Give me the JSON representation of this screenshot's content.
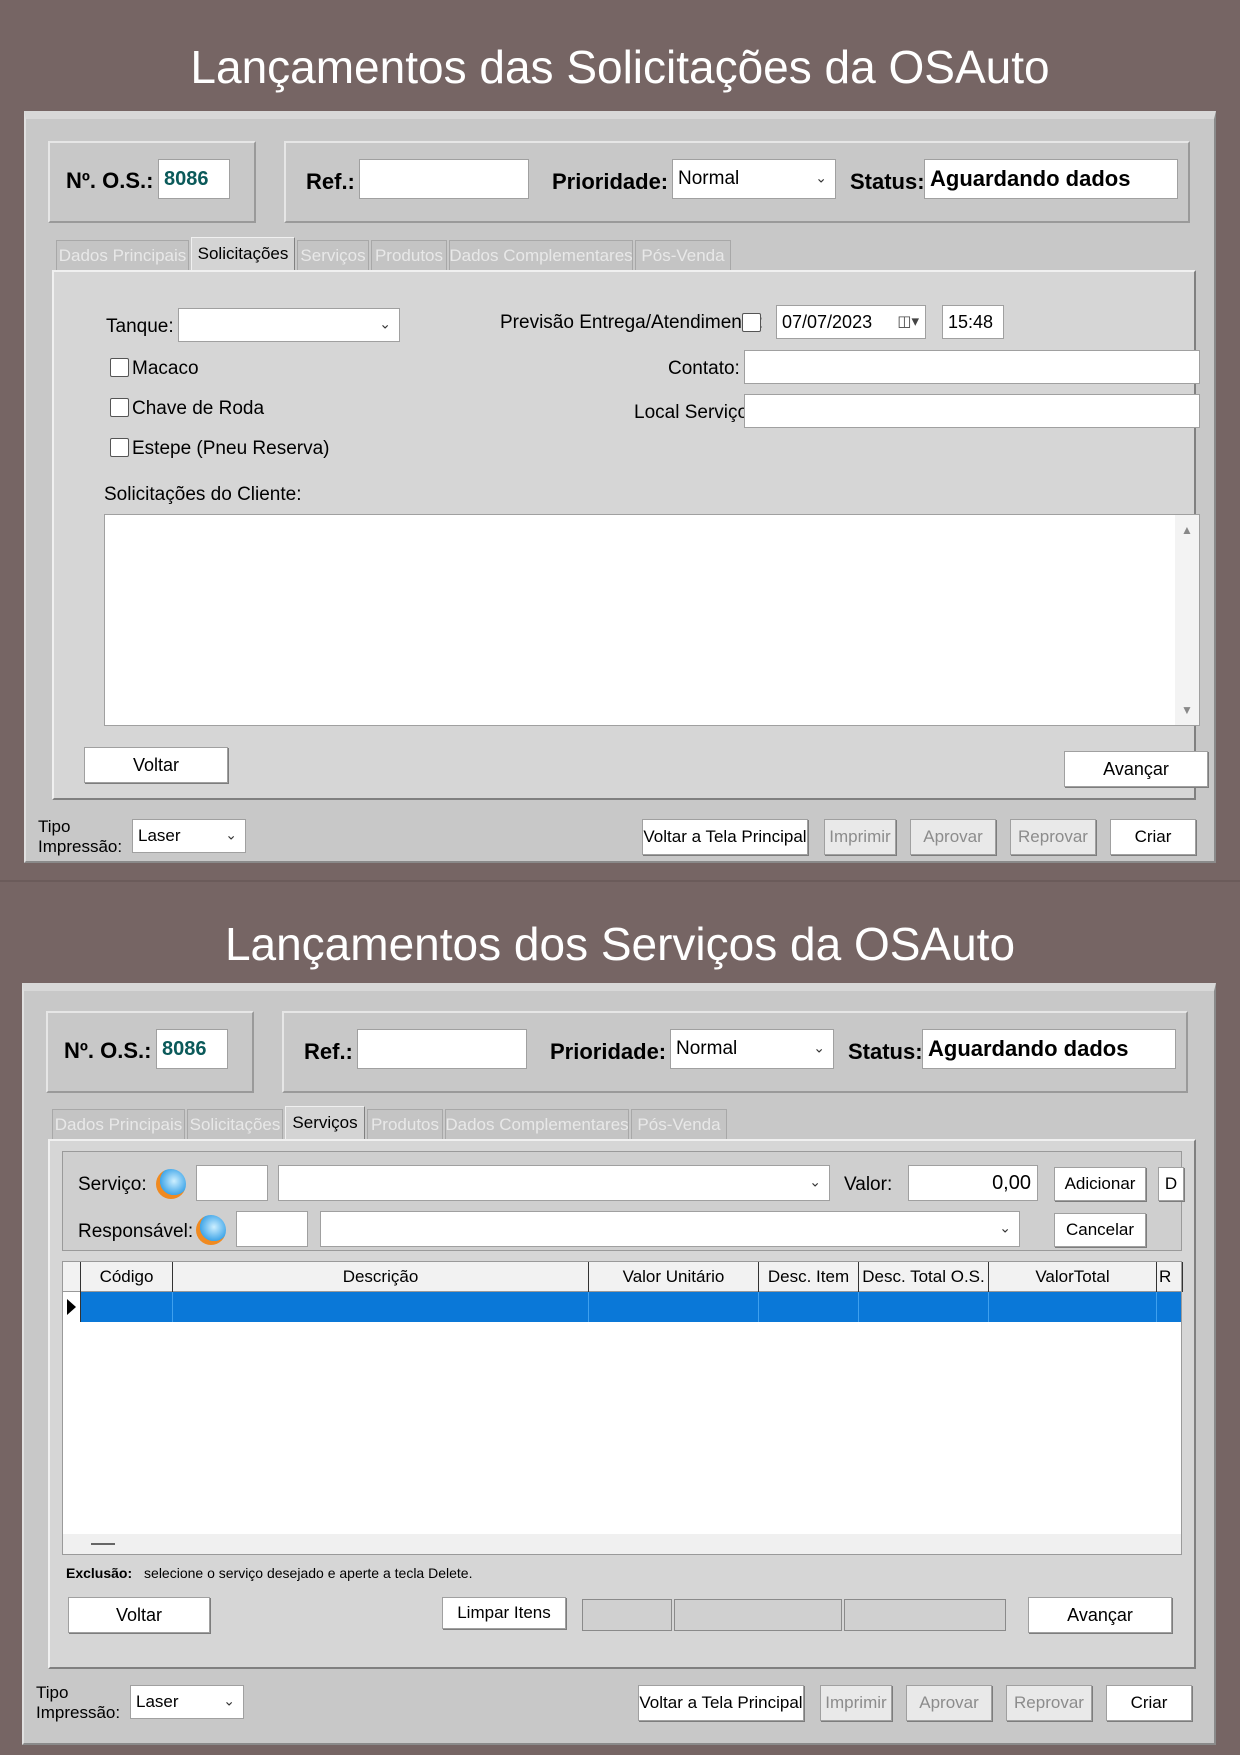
{
  "titles": {
    "top": "Lançamentos das Solicitações da OSAuto",
    "bottom": "Lançamentos dos Serviços da OSAuto"
  },
  "colors": {
    "background": "#766564",
    "window": "#c8c8c8",
    "selection": "#0a78d8",
    "os_number": "#0b5a5a"
  },
  "header": {
    "os_label": "Nº. O.S.:",
    "os_value": "8086",
    "ref_label": "Ref.:",
    "ref_value": "",
    "priority_label": "Prioridade:",
    "priority_value": "Normal",
    "status_label": "Status:",
    "status_value": "Aguardando dados"
  },
  "tabs": [
    {
      "label": "Dados Principais"
    },
    {
      "label": "Solicitações"
    },
    {
      "label": "Serviços"
    },
    {
      "label": "Produtos"
    },
    {
      "label": "Dados Complementares"
    },
    {
      "label": "Pós-Venda"
    }
  ],
  "solicitacoes": {
    "tank_label": "Tanque:",
    "tank_value": "",
    "checkboxes": [
      {
        "label": "Macaco",
        "checked": false
      },
      {
        "label": "Chave de Roda",
        "checked": false
      },
      {
        "label": "Estepe (Pneu Reserva)",
        "checked": false
      }
    ],
    "forecast_label": "Previsão Entrega/Atendimento:",
    "forecast_checked": false,
    "forecast_date": "07/07/2023",
    "forecast_time": "15:48",
    "contact_label": "Contato:",
    "contact_value": "",
    "service_location_label": "Local Serviço:",
    "service_location_value": "",
    "client_requests_label": "Solicitações do Cliente:",
    "client_requests_value": ""
  },
  "servicos": {
    "service_label": "Serviço:",
    "service_code": "",
    "service_desc": "",
    "value_label": "Valor:",
    "value": "0,00",
    "add_button": "Adicionar",
    "d_button": "D",
    "responsible_label": "Responsável:",
    "responsible_code": "",
    "responsible_name": "",
    "cancel_button": "Cancelar",
    "columns": [
      "Código",
      "Descrição",
      "Valor Unitário",
      "Desc. Item",
      "Desc. Total O.S.",
      "ValorTotal",
      "R"
    ],
    "deletion_label": "Exclusão:",
    "deletion_text": "selecione o serviço desejado e aperte a tecla Delete.",
    "clear_button": "Limpar Itens"
  },
  "nav": {
    "back": "Voltar",
    "next": "Avançar"
  },
  "footer": {
    "print_type_label_1": "Tipo",
    "print_type_label_2": "Impressão:",
    "print_type_value": "Laser",
    "main_screen_button": "Voltar a Tela Principal",
    "print_button": "Imprimir",
    "approve_button": "Aprovar",
    "reject_button": "Reprovar",
    "create_button": "Criar"
  }
}
